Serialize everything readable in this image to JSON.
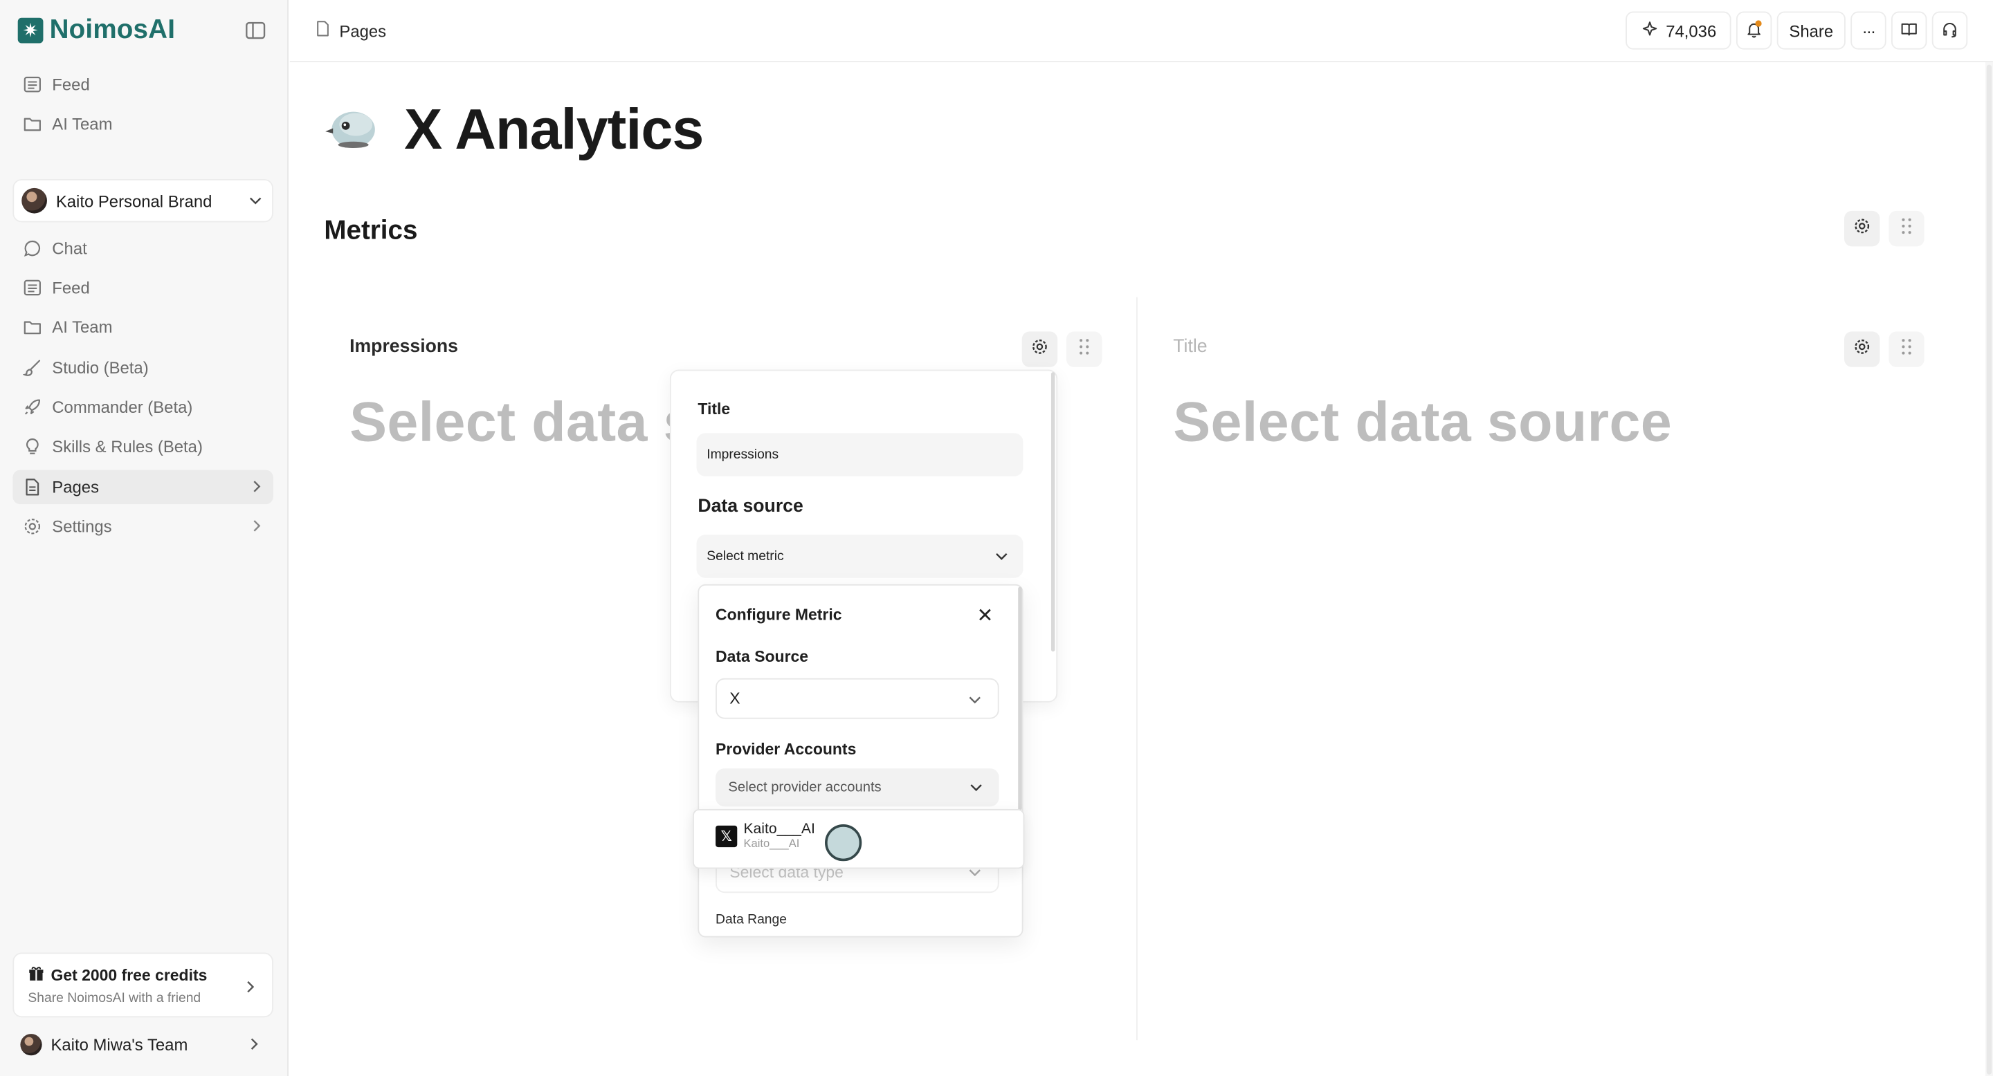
{
  "app": {
    "name": "NoimosAI"
  },
  "sidebar": {
    "top_items": [
      {
        "label": "Feed",
        "icon": "feed-icon"
      },
      {
        "label": "AI Team",
        "icon": "folder-icon"
      }
    ],
    "workspace": {
      "name": "Kaito Personal Brand"
    },
    "items": [
      {
        "label": "Chat",
        "icon": "chat-icon"
      },
      {
        "label": "Feed",
        "icon": "feed-icon"
      },
      {
        "label": "AI Team",
        "icon": "folder-icon"
      },
      {
        "label": "Studio (Beta)",
        "icon": "brush-icon"
      },
      {
        "label": "Commander (Beta)",
        "icon": "rocket-icon"
      },
      {
        "label": "Skills & Rules (Beta)",
        "icon": "bulb-icon"
      },
      {
        "label": "Pages",
        "icon": "page-icon",
        "active": true
      },
      {
        "label": "Settings",
        "icon": "gear-icon"
      }
    ],
    "credits": {
      "title": "Get 2000 free credits",
      "subtitle": "Share NoimosAI with a friend"
    },
    "team": {
      "name": "Kaito Miwa's Team"
    }
  },
  "topbar": {
    "breadcrumb": "Pages",
    "credits_count": "74,036",
    "share_label": "Share",
    "more_label": "···"
  },
  "page": {
    "emoji_name": "bird-icon",
    "title": "X Analytics",
    "section": "Metrics",
    "cards": [
      {
        "title": "Impressions",
        "placeholder": "Select data source"
      },
      {
        "title": "Title",
        "placeholder": "Select data source"
      }
    ]
  },
  "settings_popover": {
    "title_label": "Title",
    "title_value": "Impressions",
    "data_source_heading": "Data source",
    "metric_placeholder": "Select metric"
  },
  "configure_metric": {
    "title": "Configure Metric",
    "data_source_label": "Data Source",
    "data_source_value": "X",
    "provider_label": "Provider Accounts",
    "provider_placeholder": "Select provider accounts",
    "data_type_placeholder": "Select data type",
    "data_range_label": "Data Range"
  },
  "account_options": [
    {
      "name": "Kaito___AI",
      "handle": "Kaito___AI"
    }
  ],
  "colors": {
    "brand": "#1f6f6a",
    "notification": "#e48a1a"
  }
}
